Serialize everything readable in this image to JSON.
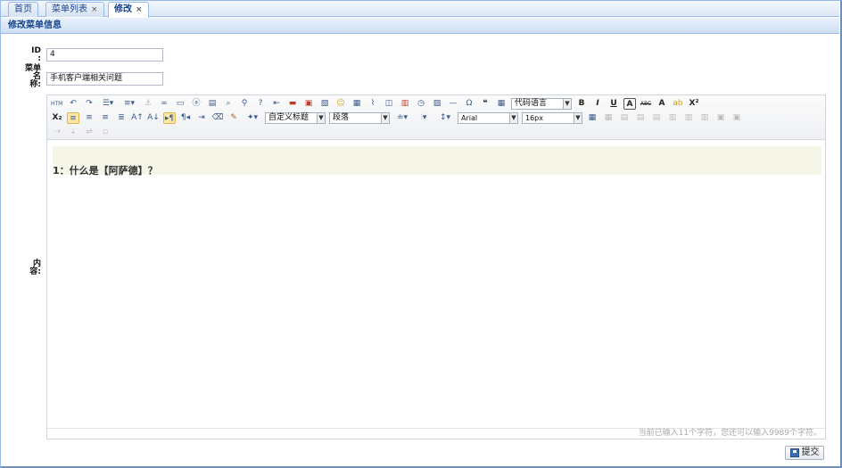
{
  "tabs": [
    {
      "label": "首页",
      "closable": false,
      "active": false
    },
    {
      "label": "菜单列表",
      "closable": true,
      "active": false
    },
    {
      "label": "修改",
      "closable": true,
      "active": true
    }
  ],
  "tab_close_glyph": "×",
  "panel": {
    "title": "修改菜单信息"
  },
  "form": {
    "id_label": [
      "ID",
      ":"
    ],
    "id_value": "4",
    "name_label": [
      "菜单",
      "名",
      "称:"
    ],
    "name_value": "手机客户端相关问题",
    "content_label": [
      "内",
      "容:"
    ]
  },
  "editor": {
    "toolbar_row1_icons": [
      "html-icon",
      "undo-icon",
      "redo-icon",
      "unordered-list-icon",
      "ordered-list-icon",
      "anchor-icon",
      "link-icon",
      "page-icon",
      "text-icon",
      "print-icon",
      "preview-icon",
      "search-replace-icon",
      "help-icon",
      "pagebreak-icon",
      "image-icon",
      "multi-image-icon",
      "insert-image-icon",
      "emoticon-icon",
      "video-icon",
      "attachment-icon",
      "map-icon",
      "date-icon",
      "time-icon",
      "template-icon",
      "horizontal-rule-icon",
      "special-char-icon",
      "blockquote-icon",
      "table-icon"
    ],
    "code_language": "代码语言",
    "format_buttons": [
      {
        "name": "bold-icon",
        "label": "B"
      },
      {
        "name": "italic-icon",
        "label": "I"
      },
      {
        "name": "underline-icon",
        "label": "U"
      },
      {
        "name": "font-border-icon",
        "label": "A"
      },
      {
        "name": "strikethrough-icon",
        "label": "ABC"
      },
      {
        "name": "font-color-icon",
        "label": "A"
      },
      {
        "name": "background-color-icon",
        "label": "ab"
      },
      {
        "name": "superscript-icon",
        "label": "X²"
      }
    ],
    "subscript_label": "X₂",
    "custom_heading": "自定义标题",
    "paragraph": "段落",
    "font_family": "Arial",
    "font_size": "16px",
    "content_text": "1：什么是【阿萨德】？",
    "word_count": "当前已输入11个字符，您还可以输入9989个字符。"
  },
  "submit_label": "提交"
}
